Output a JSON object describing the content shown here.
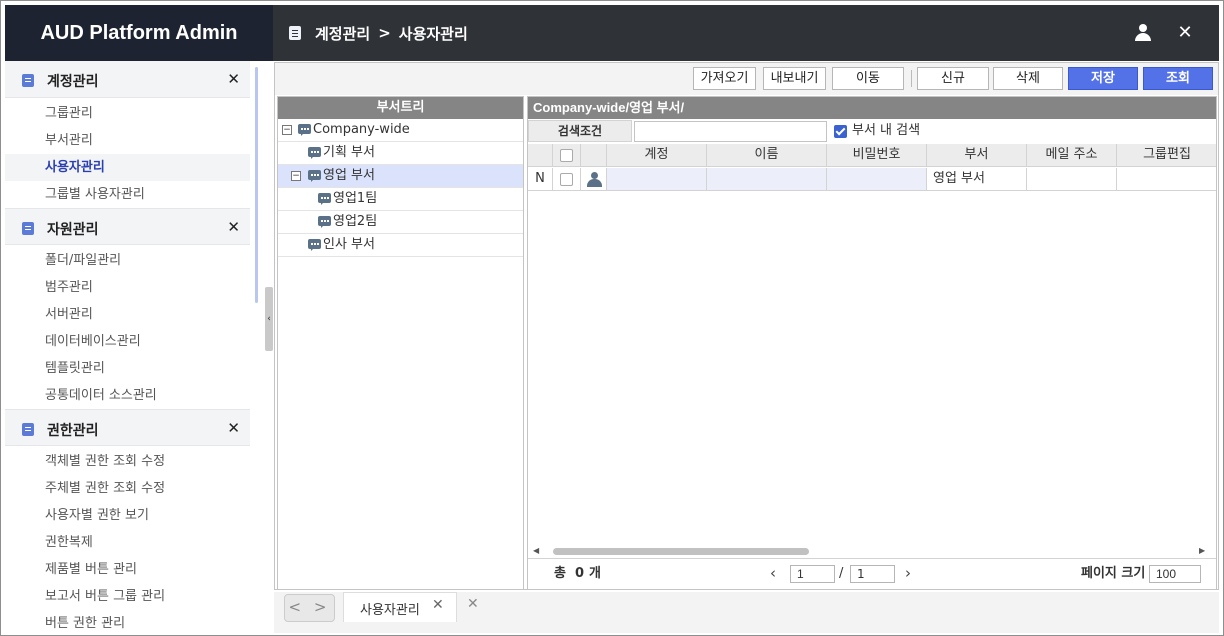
{
  "app": {
    "title": "AUD Platform Admin"
  },
  "breadcrumb": {
    "parent": "계정관리",
    "separator": ">",
    "current": "사용자관리"
  },
  "header": {
    "close_label": "✕"
  },
  "sidebar": {
    "sections": [
      {
        "title": "계정관리",
        "close": "✕",
        "items": [
          "그룹관리",
          "부서관리",
          "사용자관리",
          "그룹별 사용자관리"
        ],
        "active_item": "사용자관리"
      },
      {
        "title": "자원관리",
        "close": "✕",
        "items": [
          "폴더/파일관리",
          "범주관리",
          "서버관리",
          "데이터베이스관리",
          "템플릿관리",
          "공통데이터 소스관리"
        ]
      },
      {
        "title": "권한관리",
        "close": "✕",
        "items": [
          "객체별 권한 조회 수정",
          "주체별 권한 조회 수정",
          "사용자별 권한 보기",
          "권한복제",
          "제품별 버튼 관리",
          "보고서 버튼 그룹 관리",
          "버튼 권한 관리"
        ]
      }
    ]
  },
  "toolbar": {
    "import": "가져오기",
    "export": "내보내기",
    "move": "이동",
    "new": "신규",
    "delete": "삭제",
    "save": "저장",
    "search": "조회"
  },
  "tree": {
    "title": "부서트리",
    "nodes": [
      {
        "label": "Company-wide",
        "toggle": "−"
      },
      {
        "label": "기획 부서"
      },
      {
        "label": "영업 부서",
        "toggle": "−",
        "selected": true
      },
      {
        "label": "영업1팀"
      },
      {
        "label": "영업2팀"
      },
      {
        "label": "인사 부서"
      }
    ]
  },
  "panel": {
    "path": "Company-wide/영업 부서/",
    "search_label": "검색조건",
    "search_value": "",
    "within_dept_label": "부서 내 검색",
    "within_dept_checked": true
  },
  "grid": {
    "columns": [
      "계정",
      "이름",
      "비밀번호",
      "부서",
      "메일 주소",
      "그룹편집"
    ],
    "rows": [
      {
        "state": "N",
        "account": "",
        "name": "",
        "password": "",
        "dept": "영업 부서",
        "email": "",
        "group": ""
      }
    ]
  },
  "footer": {
    "total_label": "총",
    "total_count": "0",
    "total_unit": "개",
    "page": "1",
    "page_sep": "/",
    "page_total": "1",
    "page_size_label": "페이지 크기",
    "page_size": "100"
  },
  "tabs": {
    "nav": "< >",
    "items": [
      {
        "label": "사용자관리",
        "close": "✕"
      }
    ],
    "close_all": "✕"
  }
}
